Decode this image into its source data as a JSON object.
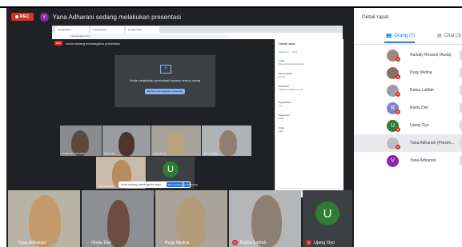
{
  "recording_badge": "REC",
  "presenter": {
    "initial": "Y",
    "title": "Yana Adharani sedang melakukan presentasi"
  },
  "shared_screen": {
    "browser_tabs": [
      "Google Meet",
      "Google Meet",
      "Google Meet"
    ],
    "address": "meet.google.com/...",
    "inner_header": "Anda sedang membagikan presentasi",
    "present_message": "Anda melakukan presentasi kepada semua orang",
    "present_button": "Berhenti membagikan presentasi",
    "inner_tiles": [
      {
        "name": "Nurlaily Rosanti (Anda)"
      },
      {
        "name": "Risdu Dwi"
      },
      {
        "name": "Pegy Melina"
      },
      {
        "name": "Ratna Latifah"
      },
      {
        "name": "Yana Adharani"
      },
      {
        "name": "Ujang Oyo",
        "initial": "U"
      }
    ],
    "chat": {
      "title": "Detail rapat",
      "tabs": [
        "Orang (7)",
        "Chat"
      ],
      "messages": [
        {
          "sender": "Anda",
          "text": "Pesan untuk peserta rapat"
        },
        {
          "sender": "Ratna Latifah",
          "text": "Aamiin"
        },
        {
          "sender": "Risdu Dwi",
          "text": "Assalamu alaikum wr wb"
        },
        {
          "sender": "Pegy Melina",
          "text": "Iya"
        },
        {
          "sender": "Ujang Oyo",
          "text": "Hadir"
        },
        {
          "sender": "Anda",
          "text": "Halo"
        }
      ],
      "input_placeholder": "Kirim pesan ke semua orang"
    },
    "banner_text": "Anda sedang membagikan layar",
    "banner_buttons": [
      "Stop berbagi",
      "Sembunyikan"
    ]
  },
  "bottom_tiles": [
    {
      "name": "Yana Adharani"
    },
    {
      "name": "Risdu Dwi"
    },
    {
      "name": "Pegy Melina"
    },
    {
      "name": "Ratna Latifah"
    },
    {
      "name": "Ujang Oyo",
      "initial": "U"
    }
  ],
  "sidebar": {
    "title": "Detail rapat",
    "tab_people": "Orang (7)",
    "tab_chat": "Chat (3)",
    "participants": [
      {
        "name": "Nurlaily Rosanti (Anda)",
        "color": "#a1887f"
      },
      {
        "name": "Pegy Melina",
        "color": "#8d6e63"
      },
      {
        "name": "Ratna Latifah",
        "color": "#9e9e9e"
      },
      {
        "name": "Risdu Dwi",
        "initial": "R",
        "color": "#7986cb"
      },
      {
        "name": "Ujang Oyo",
        "initial": "U",
        "color": "#2e7d32"
      },
      {
        "name": "Yana Adharani (Presen...",
        "color": "#bdbdbd"
      },
      {
        "name": "Yana Adharani",
        "initial": "V",
        "color": "#8e24aa"
      }
    ]
  },
  "colors": {
    "meet_bg": "#202124",
    "rec_red": "#d93025",
    "accent": "#1a73e8",
    "green": "#2e7d32"
  }
}
